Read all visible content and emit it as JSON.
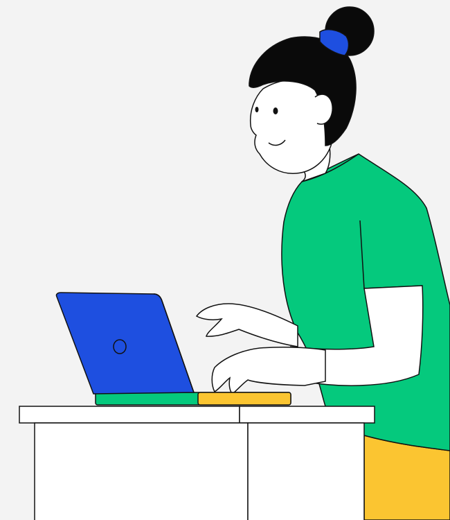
{
  "colors": {
    "background": "#f3f3f3",
    "outline": "#111111",
    "shirt": "#05c97d",
    "pants": "#fbc531",
    "laptop": "#1e4fe0",
    "hair_tie": "#1e4fe0",
    "skin": "#ffffff",
    "desk": "#ffffff",
    "hair": "#0a0a0a"
  },
  "icons": {
    "person": "woman-using-laptop-icon",
    "laptop": "laptop-icon",
    "desk": "desk-icon"
  }
}
